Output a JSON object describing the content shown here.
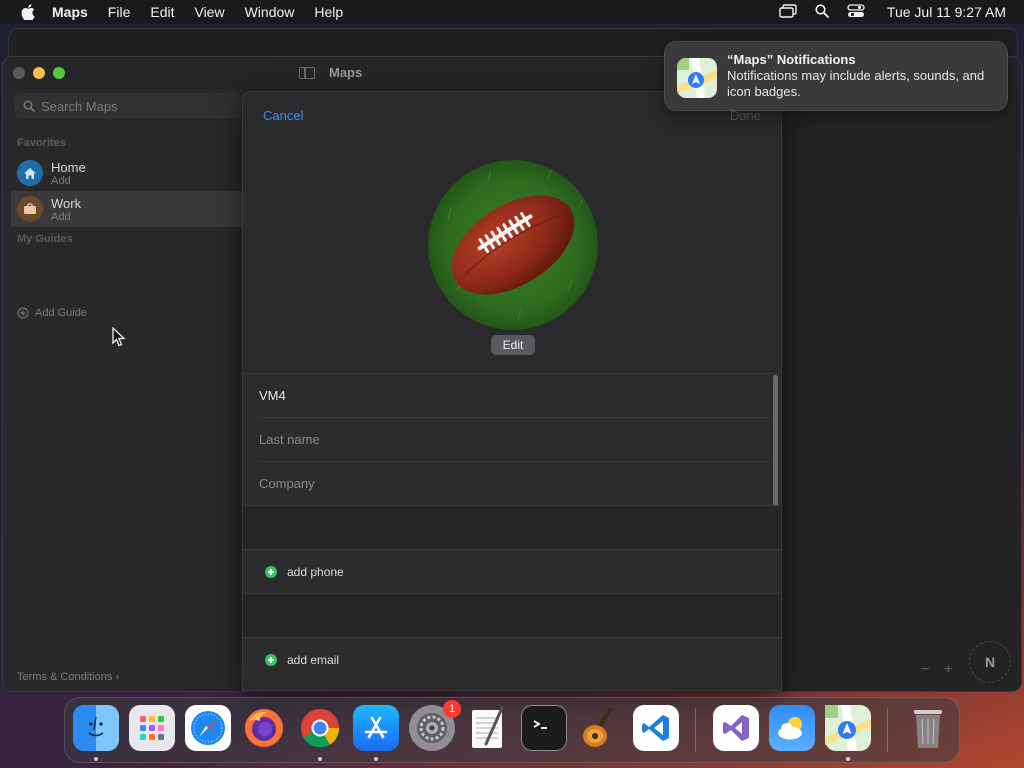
{
  "menubar": {
    "app_name": "Maps",
    "items": [
      "File",
      "Edit",
      "View",
      "Window",
      "Help"
    ],
    "clock": "Tue Jul 11  9:27 AM"
  },
  "window": {
    "title": "Maps"
  },
  "sidebar": {
    "search_placeholder": "Search Maps",
    "favorites_label": "Favorites",
    "favorites": [
      {
        "title": "Home",
        "subtitle": "Add"
      },
      {
        "title": "Work",
        "subtitle": "Add"
      }
    ],
    "guides_label": "My Guides",
    "add_guide": "Add Guide",
    "terms": "Terms & Conditions"
  },
  "map": {
    "compass": "N",
    "zoom_out": "−",
    "zoom_in": "+"
  },
  "sheet": {
    "cancel": "Cancel",
    "done": "Done",
    "edit": "Edit",
    "fields": [
      {
        "value": "VM4",
        "filled": true
      },
      {
        "value": "Last name",
        "filled": false
      },
      {
        "value": "Company",
        "filled": false
      }
    ],
    "add_phone": "add phone",
    "add_email": "add email"
  },
  "notification": {
    "title": "“Maps” Notifications",
    "body": "Notifications may include alerts, sounds, and icon badges."
  },
  "dock": {
    "apps": [
      "Finder",
      "Launchpad",
      "Safari",
      "Firefox",
      "Chrome",
      "App Store",
      "System Settings",
      "TextEdit",
      "Terminal",
      "GarageBand",
      "Visual Studio Code",
      "Visual Studio",
      "Weather",
      "Maps",
      "Trash"
    ],
    "settings_badge": "1"
  },
  "colors": {
    "accent": "#3b8cff",
    "add_green": "#34c759",
    "badge_red": "#ff3b30"
  }
}
